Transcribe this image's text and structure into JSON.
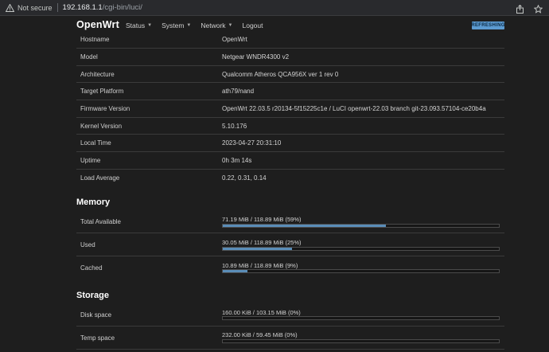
{
  "browser": {
    "security_label": "Not secure",
    "url_host": "192.168.1.1",
    "url_path": "/cgi-bin/luci/"
  },
  "header": {
    "brand": "OpenWrt",
    "nav": [
      {
        "label": "Status",
        "has_menu": true
      },
      {
        "label": "System",
        "has_menu": true
      },
      {
        "label": "Network",
        "has_menu": true
      },
      {
        "label": "Logout",
        "has_menu": false
      }
    ],
    "refresh_badge": "REFRESHING",
    "accent_color": "#5c9bd1"
  },
  "system": [
    {
      "key": "Hostname",
      "value": "OpenWrt"
    },
    {
      "key": "Model",
      "value": "Netgear WNDR4300 v2"
    },
    {
      "key": "Architecture",
      "value": "Qualcomm Atheros QCA956X ver 1 rev 0"
    },
    {
      "key": "Target Platform",
      "value": "ath79/nand"
    },
    {
      "key": "Firmware Version",
      "value": "OpenWrt 22.03.5 r20134-5f15225c1e / LuCI openwrt-22.03 branch git-23.093.57104-ce20b4a"
    },
    {
      "key": "Kernel Version",
      "value": "5.10.176"
    },
    {
      "key": "Local Time",
      "value": "2023-04-27 20:31:10"
    },
    {
      "key": "Uptime",
      "value": "0h 3m 14s"
    },
    {
      "key": "Load Average",
      "value": "0.22, 0.31, 0.14"
    }
  ],
  "memory": {
    "title": "Memory",
    "rows": [
      {
        "key": "Total Available",
        "value": "71.19 MiB / 118.89 MiB (59%)",
        "percent": 59
      },
      {
        "key": "Used",
        "value": "30.05 MiB / 118.89 MiB (25%)",
        "percent": 25
      },
      {
        "key": "Cached",
        "value": "10.89 MiB / 118.89 MiB (9%)",
        "percent": 9
      }
    ]
  },
  "storage": {
    "title": "Storage",
    "rows": [
      {
        "key": "Disk space",
        "value": "160.00 KiB / 103.15 MiB (0%)",
        "percent": 0
      },
      {
        "key": "Temp space",
        "value": "232.00 KiB / 59.45 MiB (0%)",
        "percent": 0
      }
    ]
  }
}
